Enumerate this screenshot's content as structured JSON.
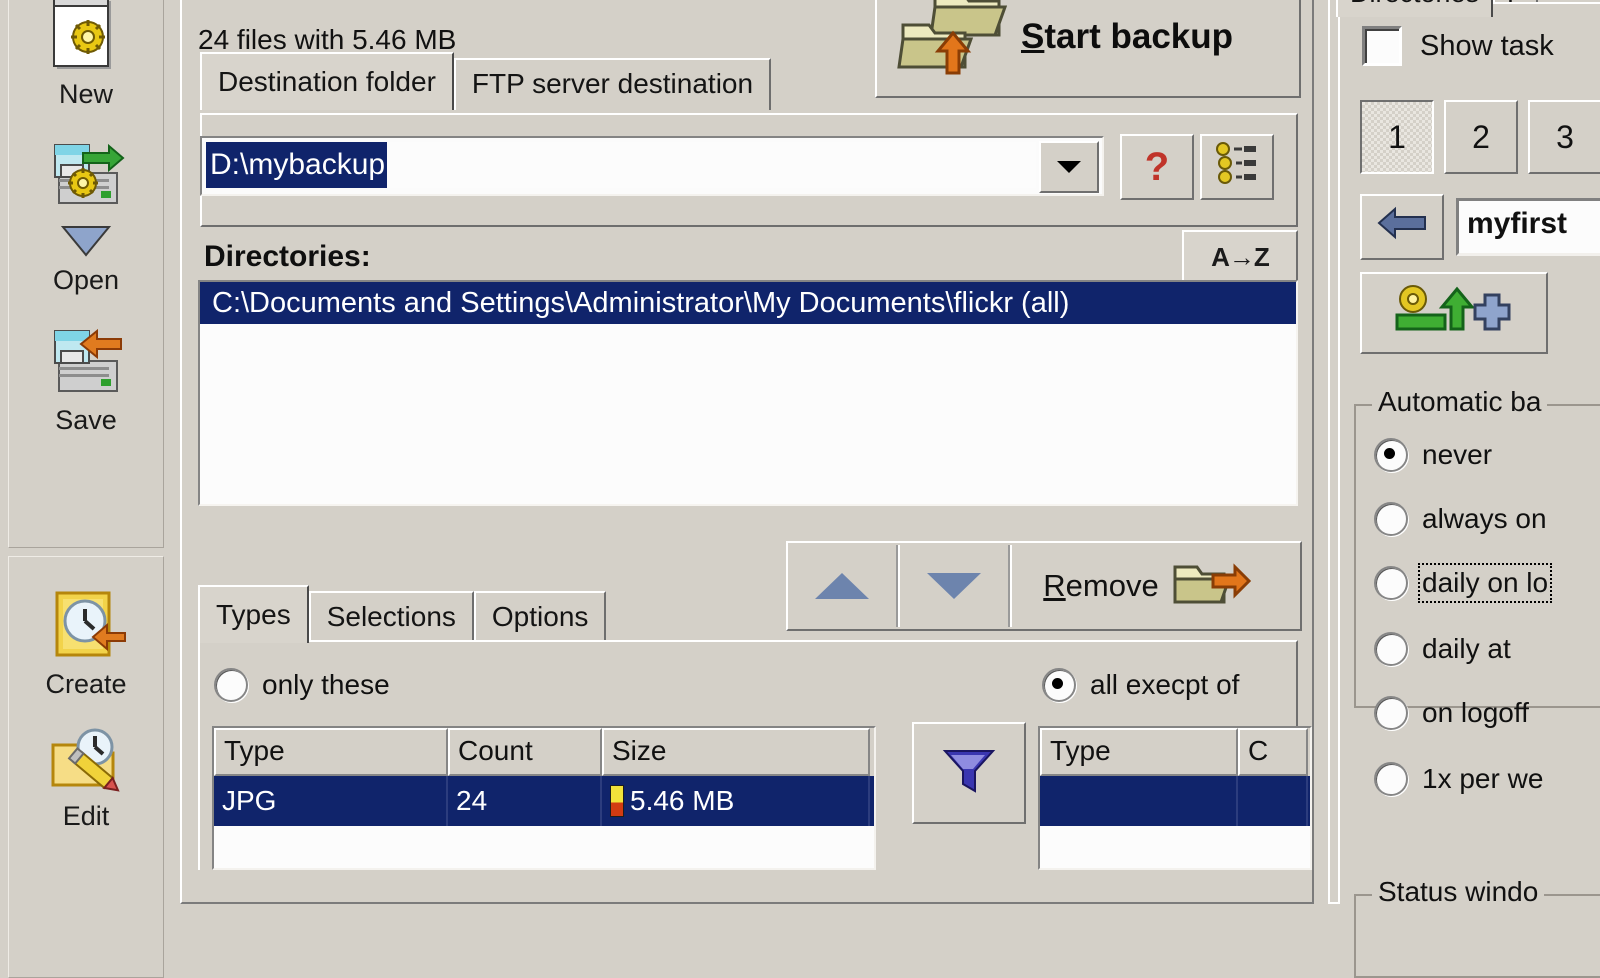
{
  "sidebar": {
    "items": [
      {
        "label": "New",
        "icon": "new-document-gear-icon"
      },
      {
        "label": "Open",
        "icon": "open-job-icon"
      },
      {
        "label": "Save",
        "icon": "save-job-icon"
      },
      {
        "label": "Create",
        "icon": "create-schedule-icon"
      },
      {
        "label": "Edit",
        "icon": "edit-schedule-icon"
      }
    ]
  },
  "center": {
    "file_summary": "24 files with 5.46 MB",
    "start_backup_label": "Start backup",
    "start_backup_accel": "S",
    "start_backup_icon": "folder-backup-arrow-icon",
    "tabs": [
      {
        "label": "Destination folder",
        "active": true
      },
      {
        "label": "FTP server destination",
        "active": false
      }
    ],
    "destination": {
      "value": "D:\\mybackup",
      "selected": true,
      "dropdown_icon": "chevron-down-icon",
      "help_button": "?",
      "browse_icon": "folder-tree-icon"
    },
    "directories": {
      "label": "Directories:",
      "sort_button": "A→Z",
      "items": [
        "C:\\Documents and Settings\\Administrator\\My Documents\\flickr (all)"
      ]
    },
    "list_toolbar": {
      "move_up_icon": "triangle-up-icon",
      "move_down_icon": "triangle-down-icon",
      "remove_label": "Remove",
      "remove_accel": "R",
      "remove_icon": "folder-remove-arrow-icon"
    },
    "lower_tabs": [
      {
        "label": "Types",
        "active": true
      },
      {
        "label": "Selections",
        "active": false
      },
      {
        "label": "Options",
        "active": false
      }
    ],
    "types": {
      "mode_only_these": "only these",
      "mode_all_except": "all execpt of",
      "selected_mode": "all execpt of",
      "filter_icon": "funnel-filter-icon",
      "left_table": {
        "columns": [
          "Type",
          "Count",
          "Size"
        ],
        "rows": [
          {
            "type": "JPG",
            "count": "24",
            "size": "5.46 MB",
            "selected": true
          }
        ]
      },
      "right_table": {
        "columns": [
          "Type",
          "C"
        ],
        "rows": [
          {
            "type": "",
            "count": "",
            "selected": true
          }
        ]
      }
    }
  },
  "right": {
    "tabs": [
      {
        "label": "Directories",
        "active": true
      },
      {
        "label": "F",
        "active": false
      }
    ],
    "show_task_label": "Show task",
    "show_task_checked": false,
    "slots": [
      {
        "label": "1",
        "pressed": true
      },
      {
        "label": "2",
        "pressed": false
      },
      {
        "label": "3",
        "pressed": false
      }
    ],
    "back_icon": "arrow-left-icon",
    "job_name": "myfirst",
    "add_task_icon": "add-task-gear-plus-icon",
    "automatic_group": {
      "caption": "Automatic ba",
      "options": [
        {
          "label": "never",
          "selected": true,
          "focused": false
        },
        {
          "label": "always on",
          "selected": false,
          "focused": false
        },
        {
          "label": "daily on lo",
          "selected": false,
          "focused": true
        },
        {
          "label": "daily at",
          "selected": false,
          "focused": false
        },
        {
          "label": "on logoff",
          "selected": false,
          "focused": false
        },
        {
          "label": "1x per we",
          "selected": false,
          "focused": false
        }
      ]
    },
    "status_group": {
      "caption": "Status windo"
    }
  },
  "colors": {
    "face": "#d4d0c8",
    "selection": "#10246b",
    "selection_text": "#ffffff",
    "field": "#fcfcfc",
    "help_red": "#c0342a"
  }
}
